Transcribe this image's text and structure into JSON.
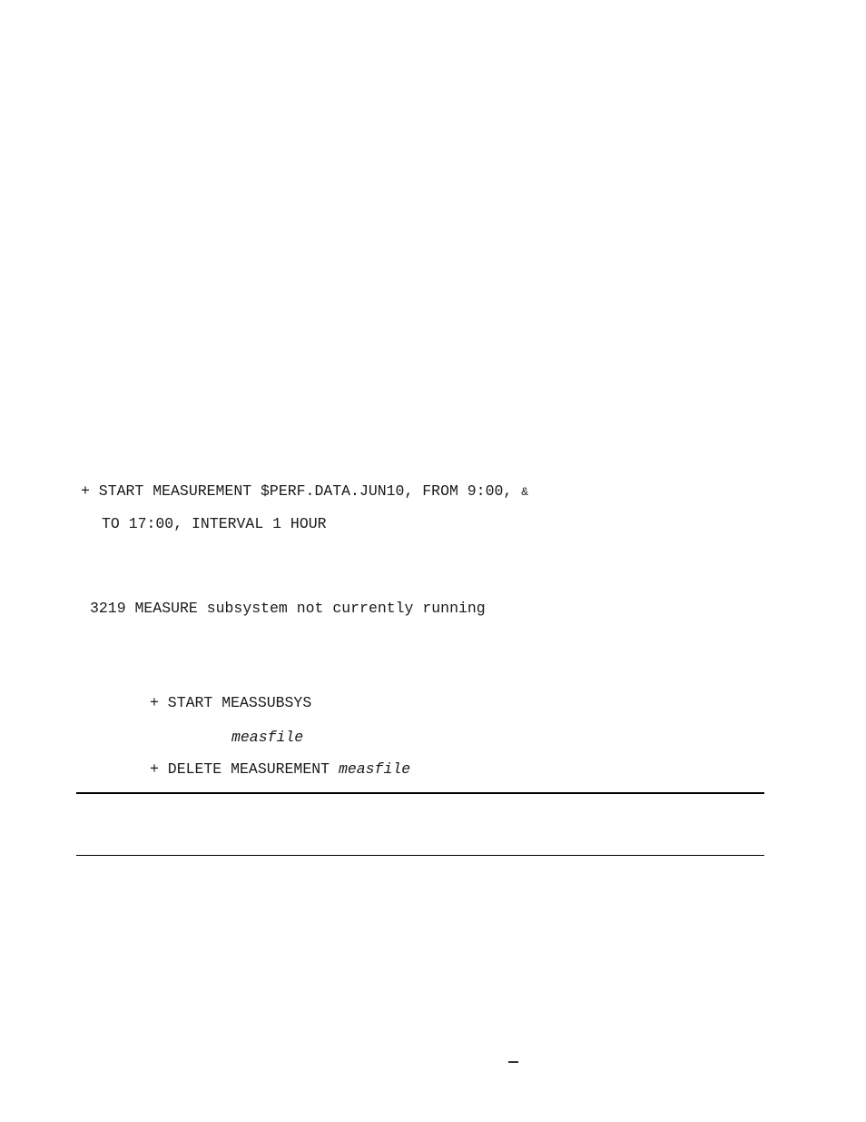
{
  "example_command": {
    "line1_prefix": "+ START MEASUREMENT $PERF.DATA.JUN10, FROM 9:00, ",
    "line1_continuation": "&",
    "line2": "TO 17:00, INTERVAL 1 HOUR"
  },
  "error_message": "3219 MEASURE subsystem not currently running",
  "recovery": {
    "step1": "+ START MEASSUBSYS",
    "step2_italic": "measfile",
    "step3_prefix": "+ DELETE MEASUREMENT ",
    "step3_italic": "measfile"
  },
  "footer": {
    "page_marker": "–"
  }
}
